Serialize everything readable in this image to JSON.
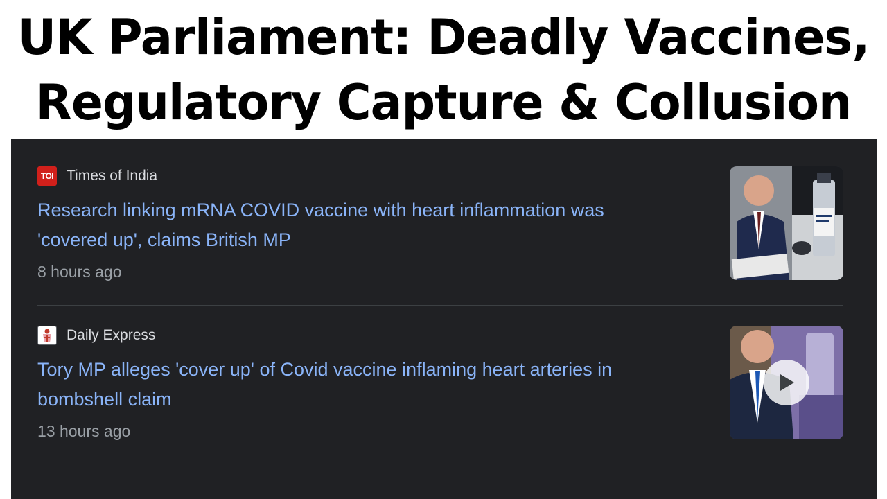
{
  "banner": {
    "line1": "UK Parliament: Deadly Vaccines,",
    "line2": "Regulatory Capture & Collusion"
  },
  "news": [
    {
      "source": "Times of India",
      "favicon_text": "TOI",
      "headline": "Research linking mRNA COVID vaccine with heart inflammation was 'covered up', claims British MP",
      "time": "8 hours ago",
      "thumbnail_icon": "news-photo",
      "has_video": false
    },
    {
      "source": "Daily Express",
      "favicon_text": "",
      "headline": "Tory MP alleges 'cover up' of Covid vaccine inflaming heart arteries in bombshell claim",
      "time": "13 hours ago",
      "thumbnail_icon": "news-video",
      "has_video": true
    }
  ],
  "colors": {
    "background": "#202124",
    "headline_link": "#8ab4f8",
    "source_text": "#dadce0",
    "time_text": "#9aa0a6",
    "toi_red": "#d1201b"
  }
}
